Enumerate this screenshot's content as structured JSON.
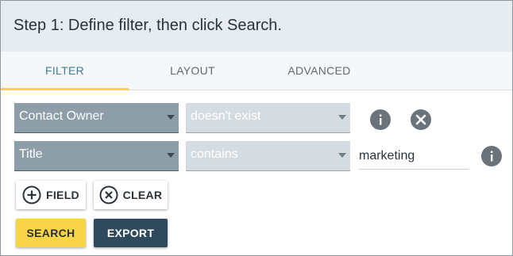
{
  "header": {
    "title": "Step 1: Define filter, then click Search."
  },
  "tabs": [
    {
      "label": "FILTER",
      "active": true
    },
    {
      "label": "LAYOUT",
      "active": false
    },
    {
      "label": "ADVANCED",
      "active": false
    }
  ],
  "filter_rows": [
    {
      "field": "Contact Owner",
      "operator": "doesn't exist",
      "value": ""
    },
    {
      "field": "Title",
      "operator": "contains",
      "value": "marketing"
    }
  ],
  "buttons": {
    "add_field": "FIELD",
    "clear": "CLEAR",
    "search": "SEARCH",
    "export": "EXPORT"
  },
  "icons": {
    "info": "info-icon",
    "remove": "close-circle-icon",
    "add": "plus-circle-icon",
    "clear": "x-circle-icon"
  },
  "colors": {
    "accent_yellow": "#f7d448",
    "dark_button": "#2f4a5c",
    "active_tab_text": "#3f7f95",
    "select_dark": "#8e9ea9",
    "select_light": "#d4dce2"
  }
}
